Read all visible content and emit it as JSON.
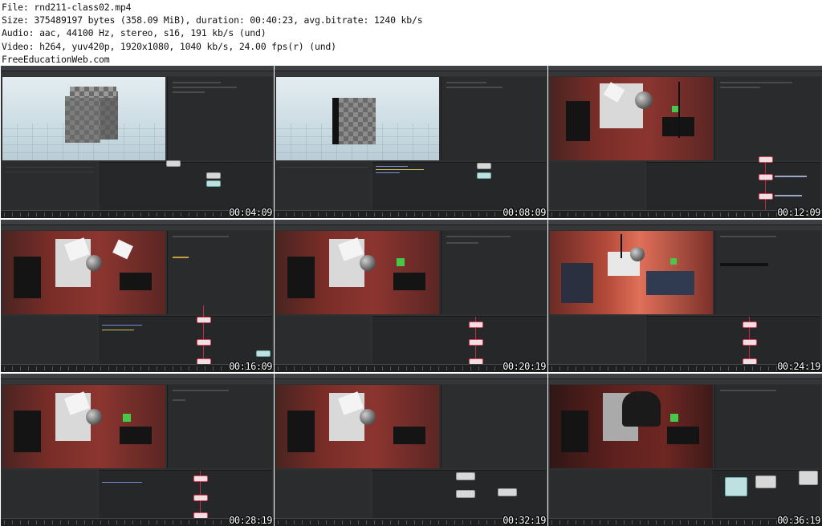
{
  "info": {
    "file": "File: rnd211-class02.mp4",
    "size": "Size: 375489197 bytes (358.09 MiB), duration: 00:40:23, avg.bitrate: 1240 kb/s",
    "audio": "Audio: aac, 44100 Hz, stereo, s16, 191 kb/s (und)",
    "video": "Video: h264, yuv420p, 1920x1080, 1040 kb/s, 24.00 fps(r) (und)",
    "site": "FreeEducationWeb.com"
  },
  "thumbnails": [
    {
      "timestamp": "00:04:09",
      "scene": "cube-sky"
    },
    {
      "timestamp": "00:08:09",
      "scene": "cube-sky"
    },
    {
      "timestamp": "00:12:09",
      "scene": "studio"
    },
    {
      "timestamp": "00:16:09",
      "scene": "studio"
    },
    {
      "timestamp": "00:20:19",
      "scene": "studio"
    },
    {
      "timestamp": "00:24:19",
      "scene": "studio-bright"
    },
    {
      "timestamp": "00:28:19",
      "scene": "studio"
    },
    {
      "timestamp": "00:32:19",
      "scene": "studio"
    },
    {
      "timestamp": "00:36:19",
      "scene": "studio-dark"
    }
  ],
  "colors": {
    "ui_background": "#2e2f31",
    "wire": "#c62a4a",
    "studio_wall": "#8c3530",
    "sky": "#cbdce3"
  }
}
